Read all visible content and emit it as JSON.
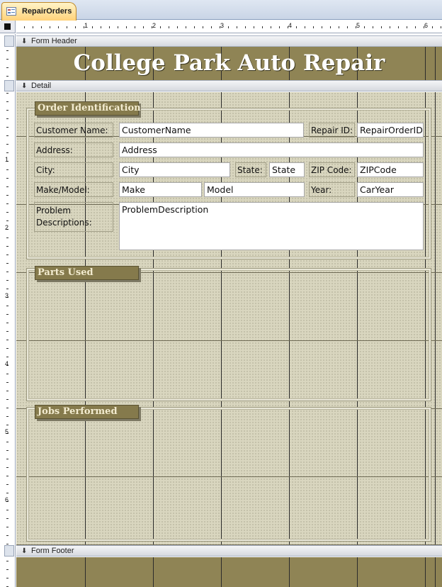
{
  "tab": {
    "title": "RepairOrders",
    "icon": "form-icon"
  },
  "ruler": {
    "horizontal_marks": [
      "1",
      "2",
      "3",
      "4",
      "5",
      "6"
    ],
    "vertical_marks": [
      "1",
      "2",
      "3",
      "4",
      "5",
      "6"
    ]
  },
  "sections": {
    "header": "Form Header",
    "detail": "Detail",
    "footer": "Form Footer"
  },
  "header": {
    "title": "College Park Auto Repair"
  },
  "groups": {
    "order": "Order Identification",
    "parts": "Parts Used",
    "jobs": "Jobs Performed"
  },
  "labels": {
    "customer_name": "Customer Name:",
    "repair_id": "Repair ID:",
    "address": "Address:",
    "city": "City:",
    "state": "State:",
    "zip": "ZIP Code:",
    "make_model": "Make/Model:",
    "year": "Year:",
    "problem": "Problem Descriptions:"
  },
  "fields": {
    "customer_name": "CustomerName",
    "repair_id": "RepairOrderID",
    "address": "Address",
    "city": "City",
    "state": "State",
    "zip": "ZIPCode",
    "make": "Make",
    "model": "Model",
    "year": "CarYear",
    "problem": "ProblemDescription"
  },
  "colors": {
    "header_band": "#8f8455",
    "detail_background": "#d9d6bf",
    "group_label": "#857a4c",
    "tab_active": "#ffd27a"
  }
}
